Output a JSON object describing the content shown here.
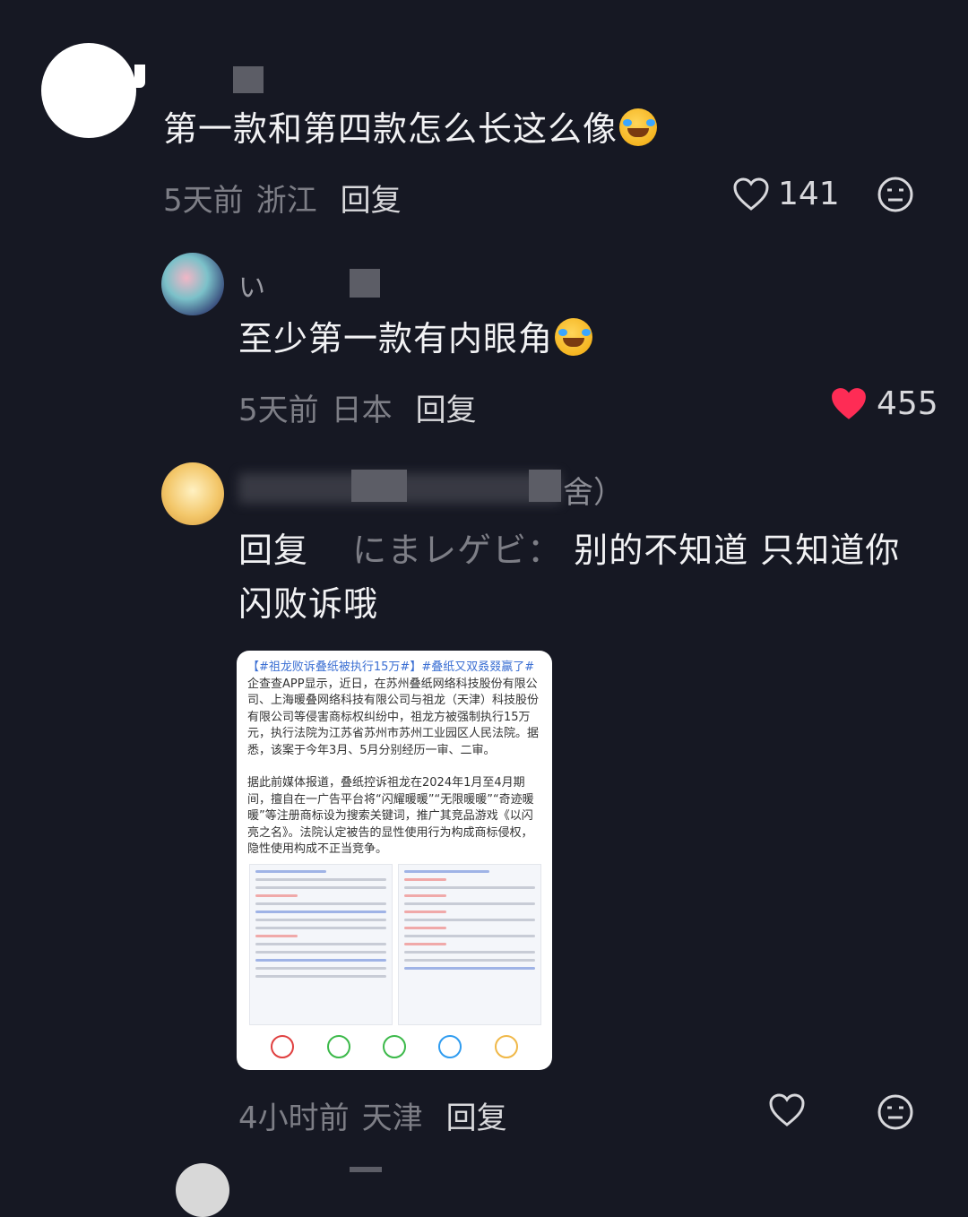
{
  "comment1": {
    "text": "第一款和第四款怎么长这么像",
    "time": "5天前",
    "location": "浙江",
    "reply_label": "回复",
    "likes": "141",
    "liked": false
  },
  "comment2": {
    "username_fragment": "い",
    "text": "至少第一款有内眼角",
    "time": "5天前",
    "location": "日本",
    "reply_label": "回复",
    "likes": "455",
    "liked": true
  },
  "comment3": {
    "username_tail": "舍）",
    "reply_prefix": "回复",
    "reply_target": "にまレゲビ：",
    "text_line1": "别的不知道 只知道你",
    "text_line2": "闪败诉哦",
    "time": "4小时前",
    "location": "天津",
    "reply_label": "回复",
    "liked": false,
    "image": {
      "hashtag1": "【#祖龙败诉叠纸被执行15万#】",
      "hashtag2": "#叠纸又双叒叕赢了#",
      "p1": " 企查查APP显示，近日，在苏州叠纸网络科技股份有限公司、上海暖叠网络科技有限公司与祖龙（天津）科技股份有限公司等侵害商标权纠纷中，祖龙方被强制执行15万元，执行法院为江苏省苏州市苏州工业园区人民法院。据悉，该案于今年3月、5月分别经历一审、二审。",
      "p2": "据此前媒体报道，叠纸控诉祖龙在2024年1月至4月期间，擅自在一广告平台将“闪耀暖暖”“无限暖暖”“奇迹暖暖”等注册商标设为搜索关键词，推广其竞品游戏《以闪亮之名》。法院认定被告的显性使用行为构成商标侵权，隐性使用构成不正当竞争。"
    }
  },
  "colors": {
    "background": "#161823",
    "like_red": "#fe2c55",
    "muted_text": "#7d7e86"
  }
}
